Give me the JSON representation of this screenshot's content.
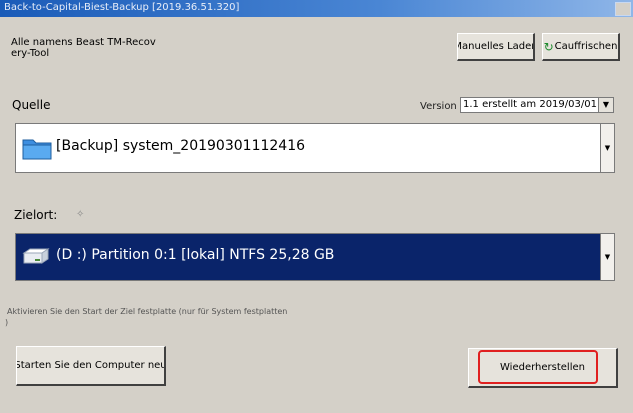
{
  "window": {
    "title": "Back-to-Capital-Biest-Backup [2019.36.51.320]"
  },
  "header": {
    "info_line1": "Alle namens Beast TM-Recov",
    "info_line2": "ery-Tool",
    "manual_button": "Manuelles Laden",
    "refresh_button": "Cauffrischen"
  },
  "source": {
    "label": "Quelle",
    "version_label": "Version",
    "version_value": "1.1 erstellt am 2019/03/01",
    "selected": "[Backup] system_20190301112416"
  },
  "target": {
    "label": "Zielort:",
    "selected": "(D :) Partition 0:1 [lokal] NTFS 25,28 GB"
  },
  "options": {
    "activate_text": "Aktivieren Sie den Start der Ziel festplatte (nur für System festplatten",
    "activate_paren": ")"
  },
  "actions": {
    "restart_button": "Starten Sie den Computer neu",
    "restore_button": "Wiederherstellen"
  },
  "colors": {
    "selection": "#0a246a",
    "highlight": "#e02020"
  }
}
